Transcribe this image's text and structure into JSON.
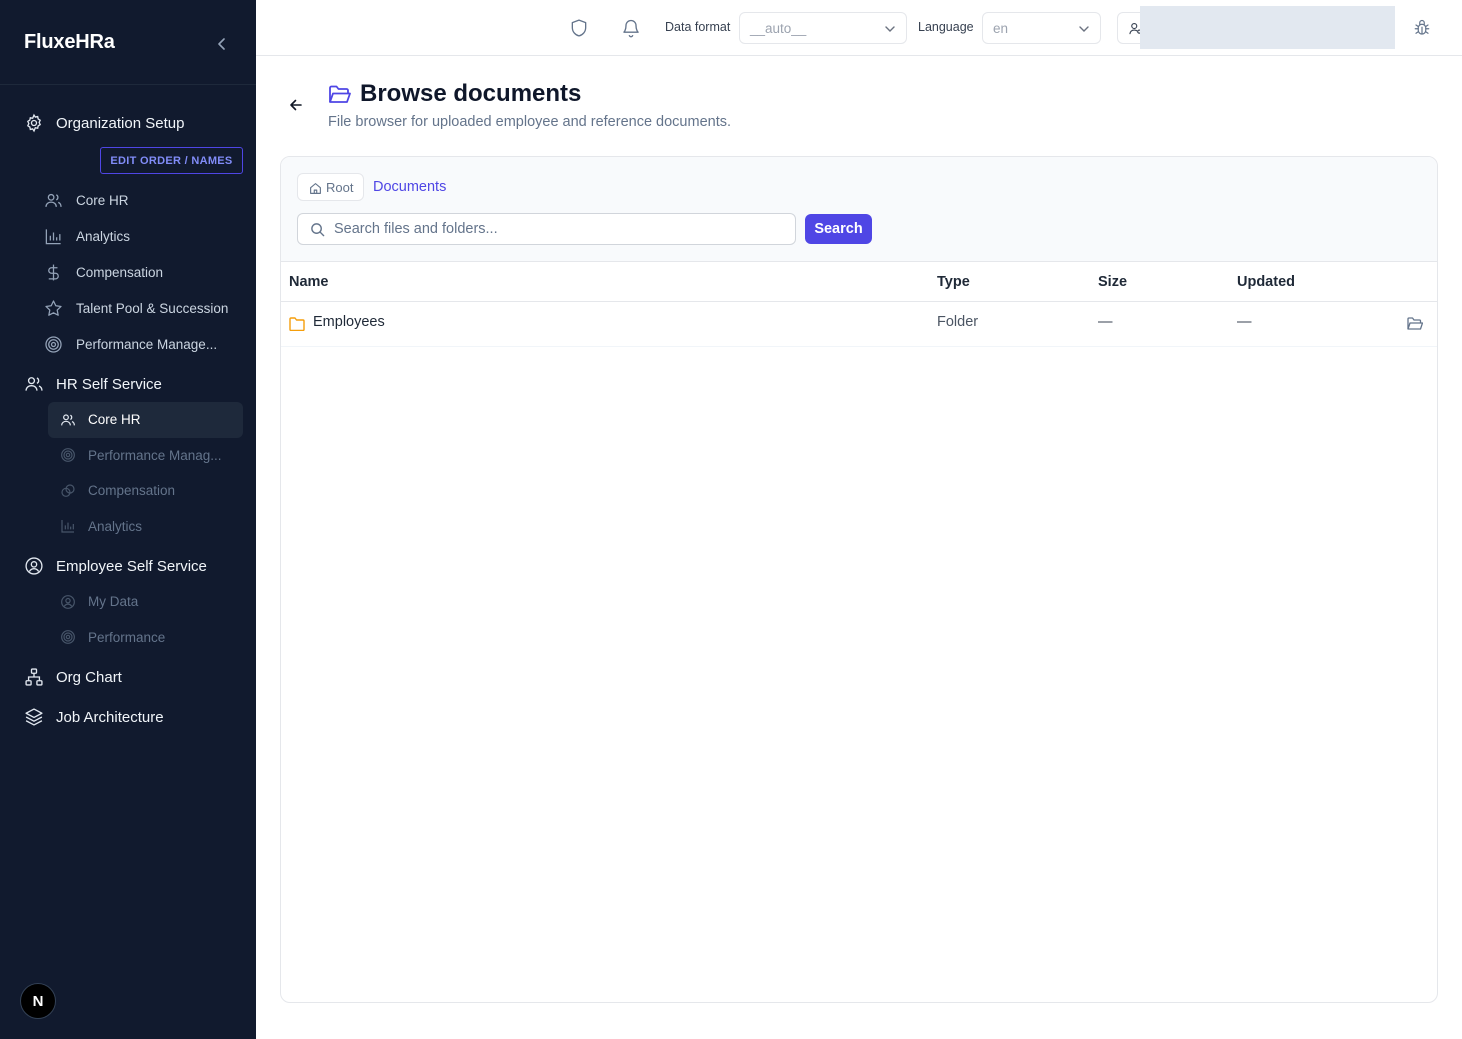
{
  "app": {
    "brand": "FluxeHRa"
  },
  "sidebar": {
    "org_setup": {
      "label": "Organization Setup",
      "edit_order": "EDIT ORDER / NAMES",
      "items": [
        {
          "label": "Core HR",
          "icon": "users-icon"
        },
        {
          "label": "Analytics",
          "icon": "bar-chart-icon"
        },
        {
          "label": "Compensation",
          "icon": "dollar-icon"
        },
        {
          "label": "Talent Pool & Succession",
          "icon": "star-icon"
        },
        {
          "label": "Performance Manage...",
          "icon": "target-icon"
        }
      ]
    },
    "hr_self_service": {
      "label": "HR Self Service",
      "items": [
        {
          "label": "Core HR",
          "icon": "users-icon",
          "active": true
        },
        {
          "label": "Performance Manag...",
          "icon": "target-icon"
        },
        {
          "label": "Compensation",
          "icon": "coins-icon"
        },
        {
          "label": "Analytics",
          "icon": "bar-chart-icon"
        }
      ]
    },
    "employee_self_service": {
      "label": "Employee Self Service",
      "items": [
        {
          "label": "My Data",
          "icon": "user-circle-icon"
        },
        {
          "label": "Performance",
          "icon": "target-icon"
        }
      ]
    },
    "org_chart": {
      "label": "Org Chart"
    },
    "job_architecture": {
      "label": "Job Architecture"
    },
    "footer_badge": "N"
  },
  "topbar": {
    "data_format_label": "Data format",
    "data_format_value": "__auto__",
    "language_label": "Language",
    "language_value": "en"
  },
  "page": {
    "title": "Browse documents",
    "subtitle": "File browser for uploaded employee and reference documents."
  },
  "browser": {
    "breadcrumb_root": "Root",
    "breadcrumb_current": "Documents",
    "search_placeholder": "Search files and folders...",
    "search_button": "Search",
    "columns": {
      "name": "Name",
      "type": "Type",
      "size": "Size",
      "updated": "Updated"
    },
    "rows": [
      {
        "name": "Employees",
        "type": "Folder",
        "size": "—",
        "updated": "—"
      }
    ]
  },
  "colors": {
    "sidebar_bg": "#111a2e",
    "accent": "#4f46e5",
    "folder": "#f59e0b"
  }
}
